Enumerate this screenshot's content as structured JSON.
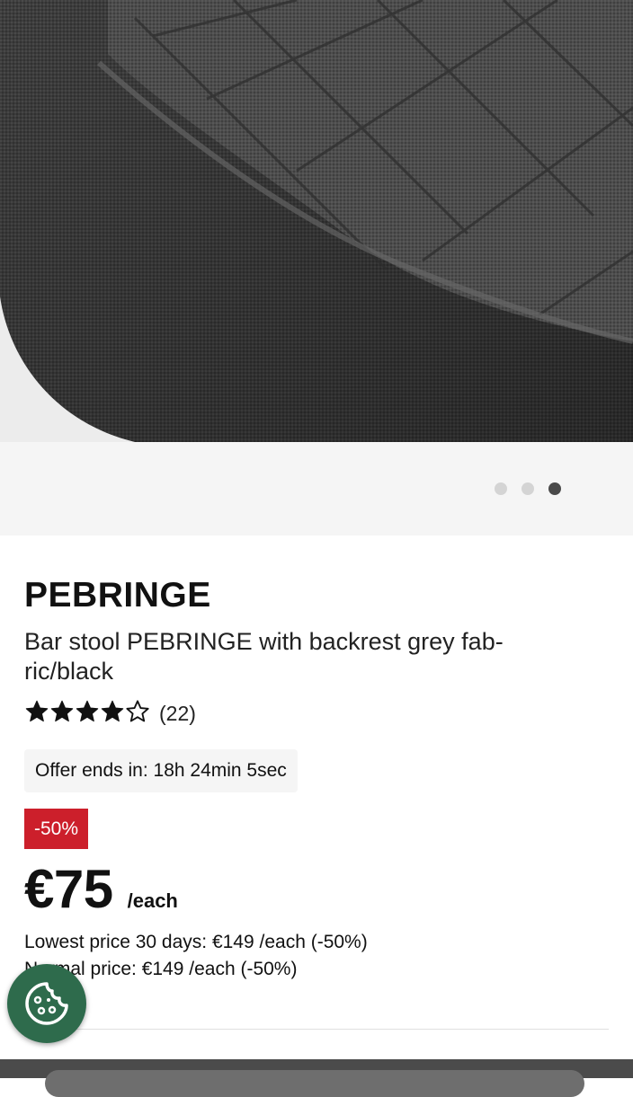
{
  "carousel": {
    "total": 3,
    "active_index": 2
  },
  "product": {
    "name": "PEBRINGE",
    "description": "Bar stool PEBRINGE with backrest grey fab-ric/black",
    "rating": {
      "value": 4.5,
      "max": 5,
      "count": "(22)"
    },
    "offer": "Offer ends in: 18h 24min 5sec",
    "discount_badge": "-50%",
    "price": "€75",
    "price_unit": "/each",
    "lowest_price": "Lowest price 30 days: €149 /each (-50%)",
    "normal_price": "Normal price: €149 /each (-50%)"
  },
  "icons": {
    "cookie_button": "cookie-settings-icon",
    "star": "star-icon"
  },
  "colors": {
    "badge": "#cc1f2b",
    "fab": "#2e6b4c",
    "fabric": "#4a4a4a"
  }
}
